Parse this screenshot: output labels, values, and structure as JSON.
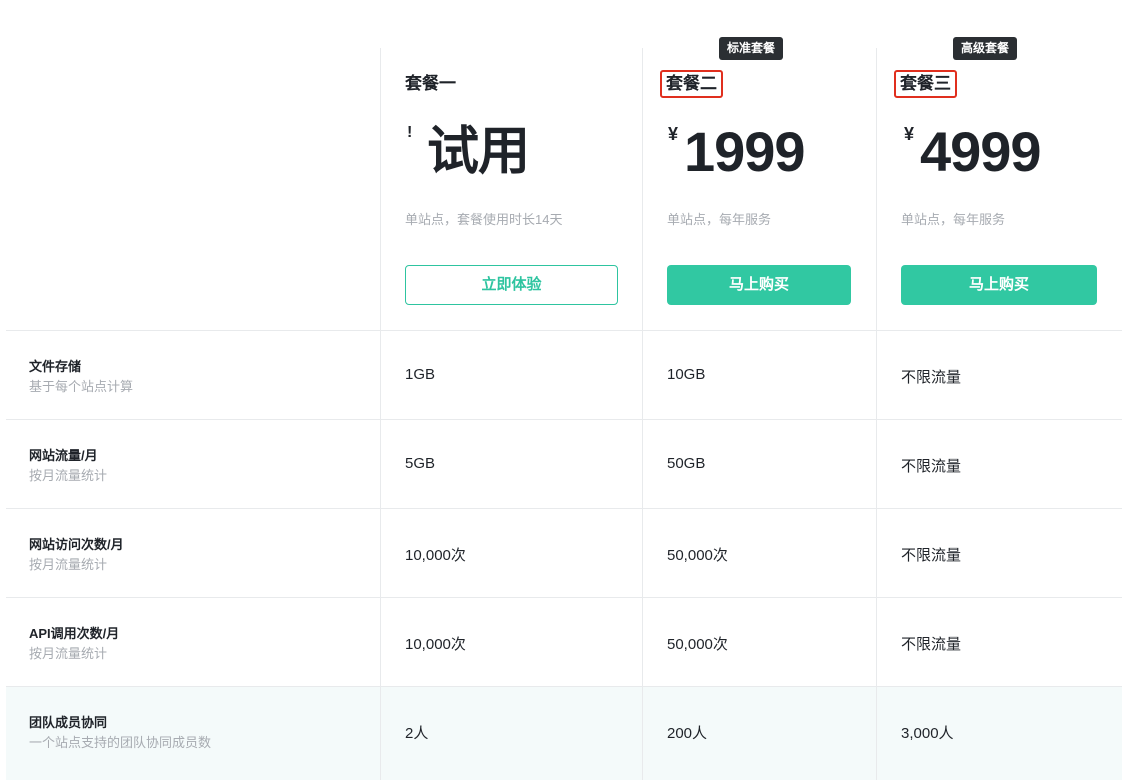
{
  "plans": [
    {
      "badge": "",
      "name": "套餐一",
      "currency": "!",
      "price": "试用",
      "desc": "单站点，套餐使用时长14天",
      "button": "立即体验",
      "button_style": "outline"
    },
    {
      "badge": "标准套餐",
      "name": "套餐二",
      "currency": "¥",
      "price": "1999",
      "desc": "单站点，每年服务",
      "button": "马上购买",
      "button_style": "solid"
    },
    {
      "badge": "高级套餐",
      "name": "套餐三",
      "currency": "¥",
      "price": "4999",
      "desc": "单站点，每年服务",
      "button": "马上购买",
      "button_style": "solid"
    }
  ],
  "features": [
    {
      "title": "文件存储",
      "subtitle": "基于每个站点计算",
      "values": [
        "1GB",
        "10GB",
        "不限流量"
      ]
    },
    {
      "title": "网站流量/月",
      "subtitle": "按月流量统计",
      "values": [
        "5GB",
        "50GB",
        "不限流量"
      ]
    },
    {
      "title": "网站访问次数/月",
      "subtitle": "按月流量统计",
      "values": [
        "10,000次",
        "50,000次",
        "不限流量"
      ]
    },
    {
      "title": "API调用次数/月",
      "subtitle": "按月流量统计",
      "values": [
        "10,000次",
        "50,000次",
        "不限流量"
      ]
    },
    {
      "title": "团队成员协同",
      "subtitle": "一个站点支持的团队协同成员数",
      "values": [
        "2人",
        "200人",
        "3,000人"
      ]
    }
  ],
  "colors": {
    "accent": "#31c8a2",
    "highlight_border": "#e02f1e",
    "badge_bg": "#2b2f33",
    "muted_text": "#a7abb1"
  }
}
